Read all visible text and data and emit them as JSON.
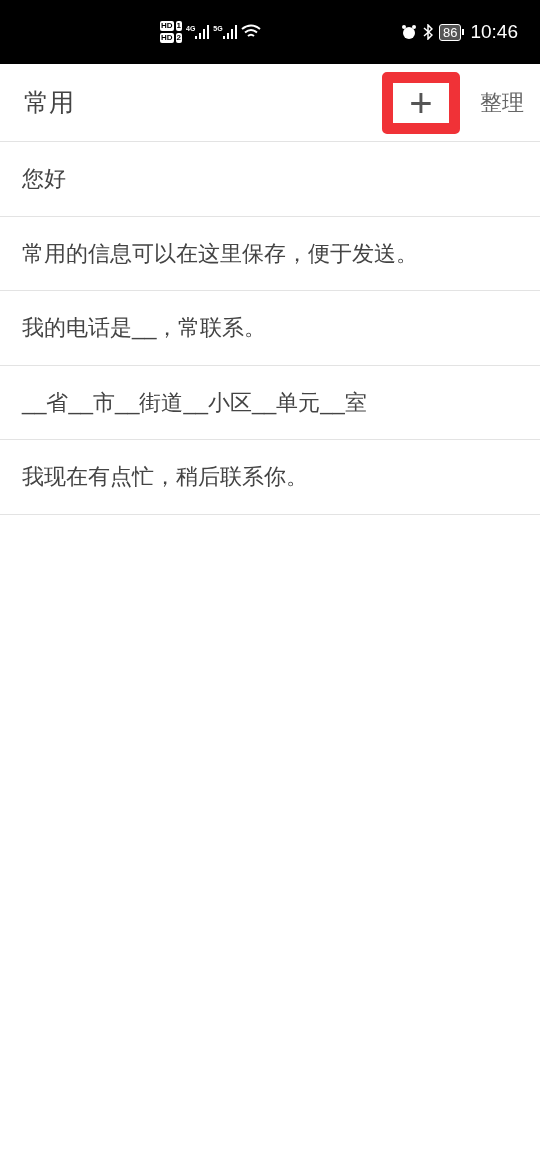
{
  "status_bar": {
    "sims": [
      {
        "label": "HD",
        "slot": "1"
      },
      {
        "label": "HD",
        "slot": "2"
      }
    ],
    "networks": [
      "4G",
      "5G"
    ],
    "battery": "86",
    "time": "10:46"
  },
  "header": {
    "title": "常用",
    "add_button": {
      "label": "+",
      "highlighted": true
    },
    "organize": "整理"
  },
  "items": [
    "您好",
    "常用的信息可以在这里保存，便于发送。",
    "我的电话是__，常联系。",
    "__省__市__街道__小区__单元__室",
    "我现在有点忙，稍后联系你。"
  ]
}
